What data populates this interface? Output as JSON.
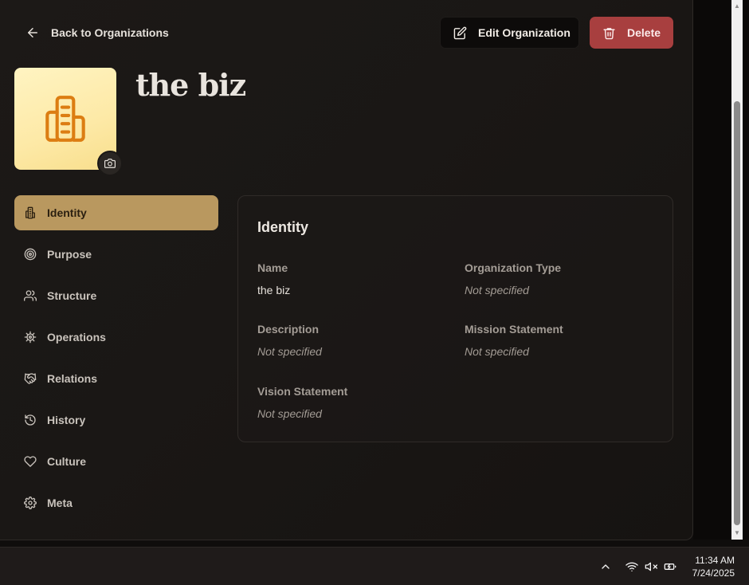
{
  "header": {
    "back_label": "Back to Organizations",
    "edit_label": "Edit Organization",
    "delete_label": "Delete"
  },
  "organization": {
    "name": "the biz"
  },
  "sidebar": {
    "items": [
      {
        "label": "Identity",
        "icon": "building-icon",
        "active": true
      },
      {
        "label": "Purpose",
        "icon": "target-icon",
        "active": false
      },
      {
        "label": "Structure",
        "icon": "users-icon",
        "active": false
      },
      {
        "label": "Operations",
        "icon": "cog-icon",
        "active": false
      },
      {
        "label": "Relations",
        "icon": "handshake-icon",
        "active": false
      },
      {
        "label": "History",
        "icon": "history-icon",
        "active": false
      },
      {
        "label": "Culture",
        "icon": "heart-icon",
        "active": false
      },
      {
        "label": "Meta",
        "icon": "gear-icon",
        "active": false
      }
    ]
  },
  "identity_card": {
    "title": "Identity",
    "name_label": "Name",
    "name_value": "the biz",
    "type_label": "Organization Type",
    "type_value": "Not specified",
    "description_label": "Description",
    "description_value": "Not specified",
    "mission_label": "Mission Statement",
    "mission_value": "Not specified",
    "vision_label": "Vision Statement",
    "vision_value": "Not specified"
  },
  "taskbar": {
    "time": "11:34 AM",
    "date": "7/24/2025"
  },
  "colors": {
    "accent": "#b9985f",
    "danger": "#a83f3f",
    "logo_bg": "#fde9a6",
    "logo_icon": "#dc7d12"
  }
}
